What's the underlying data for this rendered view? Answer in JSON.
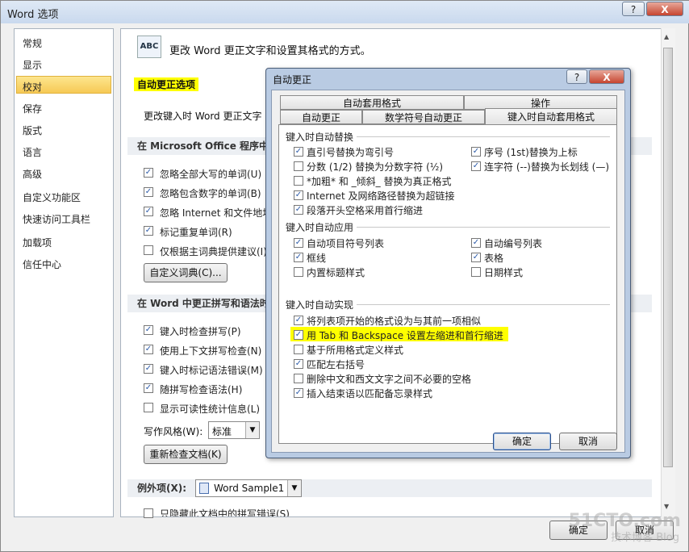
{
  "outer": {
    "title": "Word 选项",
    "help_btn": "?",
    "close_btn": "X",
    "sidebar": [
      "常规",
      "显示",
      "校对",
      "保存",
      "版式",
      "语言",
      "高级",
      "自定义功能区",
      "快速访问工具栏",
      "加载项",
      "信任中心"
    ],
    "selected_sidebar": "校对",
    "header_text": "更改 Word 更正文字和设置其格式的方式。",
    "header_icon": "ABC",
    "autocorrect_section": "自动更正选项",
    "autocorrect_desc": "更改键入时 Word 更正文字",
    "ms_office_section": "在 Microsoft Office 程序中更",
    "office_options": [
      {
        "label": "忽略全部大写的单词(U)",
        "checked": true
      },
      {
        "label": "忽略包含数字的单词(B)",
        "checked": true
      },
      {
        "label": "忽略 Internet 和文件地址",
        "checked": true
      },
      {
        "label": "标记重复单词(R)",
        "checked": true
      },
      {
        "label": "仅根据主词典提供建议(I)",
        "checked": false
      }
    ],
    "custom_dict_btn": "自定义词典(C)...",
    "word_section": "在 Word 中更正拼写和语法时",
    "word_options": [
      {
        "label": "键入时检查拼写(P)",
        "checked": true
      },
      {
        "label": "使用上下文拼写检查(N)",
        "checked": true
      },
      {
        "label": "键入时标记语法错误(M)",
        "checked": true
      },
      {
        "label": "随拼写检查语法(H)",
        "checked": true
      },
      {
        "label": "显示可读性统计信息(L)",
        "checked": false
      }
    ],
    "writing_style_label": "写作风格(W):",
    "writing_style_value": "标准",
    "recheck_btn": "重新检查文档(K)",
    "exceptions_label": "例外项(X):",
    "exceptions_value": "Word Sample1",
    "last_option": "只隐藏此文档中的拼写错误(S)",
    "ok": "确定",
    "cancel": "取消"
  },
  "inner": {
    "title": "自动更正",
    "help_btn": "?",
    "close_btn": "X",
    "tabs_row1": [
      "自动套用格式",
      "操作"
    ],
    "tabs_row2": [
      "自动更正",
      "数学符号自动更正",
      "键入时自动套用格式"
    ],
    "active_tab": "键入时自动套用格式",
    "group1": "键入时自动替换",
    "group1_left": [
      {
        "label": "直引号替换为弯引号",
        "checked": true
      },
      {
        "label": "分数 (1/2) 替换为分数字符 (½)",
        "checked": false
      },
      {
        "label": "*加粗* 和 _倾斜_ 替换为真正格式",
        "checked": false
      },
      {
        "label": "Internet 及网络路径替换为超链接",
        "checked": true
      },
      {
        "label": "段落开头空格采用首行缩进",
        "checked": true
      }
    ],
    "group1_right": [
      {
        "label": "序号 (1st)替换为上标",
        "checked": true
      },
      {
        "label": "连字符 (--)替换为长划线 (—)",
        "checked": true
      }
    ],
    "group2": "键入时自动应用",
    "group2_left": [
      {
        "label": "自动项目符号列表",
        "checked": true
      },
      {
        "label": "框线",
        "checked": true
      },
      {
        "label": "内置标题样式",
        "checked": false
      }
    ],
    "group2_right": [
      {
        "label": "自动编号列表",
        "checked": true
      },
      {
        "label": "表格",
        "checked": true
      },
      {
        "label": "日期样式",
        "checked": false
      }
    ],
    "group3": "键入时自动实现",
    "group3_items": [
      {
        "label": "将列表项开始的格式设为与其前一项相似",
        "checked": true
      },
      {
        "label": "用 Tab 和 Backspace 设置左缩进和首行缩进",
        "checked": true
      },
      {
        "label": "基于所用格式定义样式",
        "checked": false
      },
      {
        "label": "匹配左右括号",
        "checked": true
      },
      {
        "label": "删除中文和西文文字之间不必要的空格",
        "checked": false
      },
      {
        "label": "插入结束语以匹配备忘录样式",
        "checked": true
      }
    ],
    "ok": "确定",
    "cancel": "取消"
  },
  "watermark": "51CTO.com",
  "watermark2": "技术博客 Blog",
  "highlight_color": "#ffff00"
}
